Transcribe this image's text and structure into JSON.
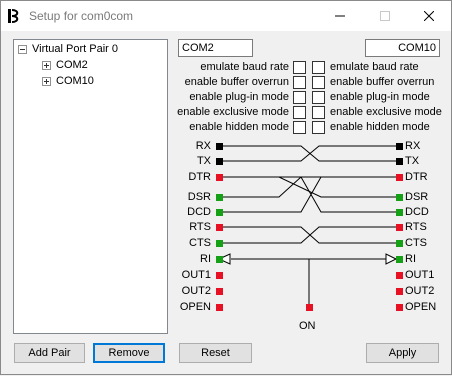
{
  "window": {
    "title": "Setup for com0com"
  },
  "tree": {
    "root": "Virtual Port Pair 0",
    "children": [
      "COM2",
      "COM10"
    ]
  },
  "ports": {
    "left": "COM2",
    "right": "COM10"
  },
  "options_left": [
    "emulate baud rate",
    "enable buffer overrun",
    "enable plug-in mode",
    "enable exclusive mode",
    "enable hidden mode"
  ],
  "options_right": [
    "emulate baud rate",
    "enable buffer overrun",
    "enable plug-in mode",
    "enable exclusive mode",
    "enable hidden mode"
  ],
  "signals_left": [
    "RX",
    "TX",
    "DTR",
    "DSR",
    "DCD",
    "RTS",
    "CTS",
    "RI",
    "OUT1",
    "OUT2",
    "OPEN"
  ],
  "signals_right": [
    "RX",
    "TX",
    "DTR",
    "DSR",
    "DCD",
    "RTS",
    "CTS",
    "RI",
    "OUT1",
    "OUT2",
    "OPEN"
  ],
  "on_label": "ON",
  "buttons": {
    "add_pair": "Add Pair",
    "remove": "Remove",
    "reset": "Reset",
    "apply": "Apply"
  },
  "colors": {
    "black_pin": "#000000",
    "red_pin": "#e81123",
    "green_pin": "#16a016",
    "default_border": "#0078d7"
  }
}
